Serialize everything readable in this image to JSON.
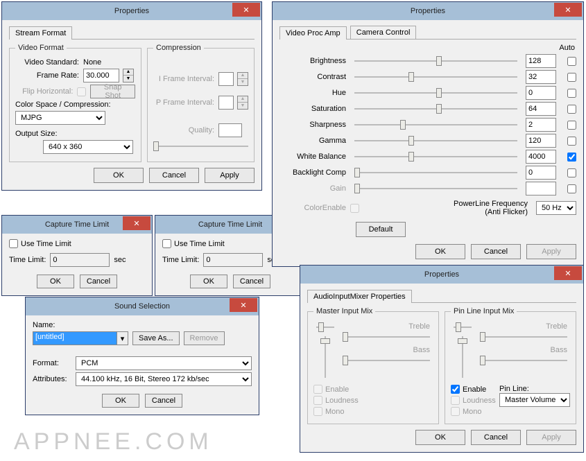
{
  "watermark": "APPNEE.COM",
  "close_glyph": "✕",
  "btn_ok": "OK",
  "btn_cancel": "Cancel",
  "btn_apply": "Apply",
  "btn_default": "Default",
  "d1": {
    "title": "Properties",
    "tab": "Stream Format",
    "vf_legend": "Video Format",
    "std_lbl": "Video Standard:",
    "std_val": "None",
    "fps_lbl": "Frame Rate:",
    "fps_val": "30.000",
    "flip_lbl": "Flip Horizontal:",
    "snap": "Snap Shot",
    "csc_lbl": "Color Space / Compression:",
    "csc_val": "MJPG",
    "out_lbl": "Output Size:",
    "out_val": "640 x 360",
    "cmp_legend": "Compression",
    "ifi_lbl": "I Frame Interval:",
    "pfi_lbl": "P Frame Interval:",
    "q_lbl": "Quality:"
  },
  "ctl": {
    "title": "Capture Time Limit",
    "use": "Use Time Limit",
    "tl_lbl": "Time Limit:",
    "tl_val": "0",
    "sec": "sec"
  },
  "snd": {
    "title": "Sound Selection",
    "name_lbl": "Name:",
    "name_val": "[untitled]",
    "saveas": "Save As...",
    "remove": "Remove",
    "fmt_lbl": "Format:",
    "fmt_val": "PCM",
    "attr_lbl": "Attributes:",
    "attr_val": "44.100 kHz, 16 Bit, Stereo                      172 kb/sec"
  },
  "vpa": {
    "title": "Properties",
    "tab1": "Video Proc Amp",
    "tab2": "Camera Control",
    "auto": "Auto",
    "rows": [
      {
        "label": "Brightness",
        "value": "128",
        "auto": false,
        "pos": 50,
        "enabled": true
      },
      {
        "label": "Contrast",
        "value": "32",
        "auto": false,
        "pos": 33,
        "enabled": true
      },
      {
        "label": "Hue",
        "value": "0",
        "auto": false,
        "pos": 50,
        "enabled": true
      },
      {
        "label": "Saturation",
        "value": "64",
        "auto": false,
        "pos": 50,
        "enabled": true
      },
      {
        "label": "Sharpness",
        "value": "2",
        "auto": false,
        "pos": 28,
        "enabled": true
      },
      {
        "label": "Gamma",
        "value": "120",
        "auto": false,
        "pos": 33,
        "enabled": true
      },
      {
        "label": "White Balance",
        "value": "4000",
        "auto": true,
        "pos": 33,
        "enabled": true
      },
      {
        "label": "Backlight Comp",
        "value": "0",
        "auto": false,
        "pos": 0,
        "enabled": true
      },
      {
        "label": "Gain",
        "value": "",
        "auto": false,
        "pos": 0,
        "enabled": false
      }
    ],
    "colorenable": "ColorEnable",
    "plf1": "PowerLine Frequency",
    "plf2": "(Anti Flicker)",
    "plf_val": "50 Hz"
  },
  "aim": {
    "title": "Properties",
    "tab": "AudioInputMixer Properties",
    "master": "Master Input Mix",
    "pin": "Pin Line Input Mix",
    "treble": "Treble",
    "bass": "Bass",
    "enable": "Enable",
    "loudness": "Loudness",
    "mono": "Mono",
    "pinline_lbl": "Pin Line:",
    "pinline_val": "Master Volume"
  }
}
